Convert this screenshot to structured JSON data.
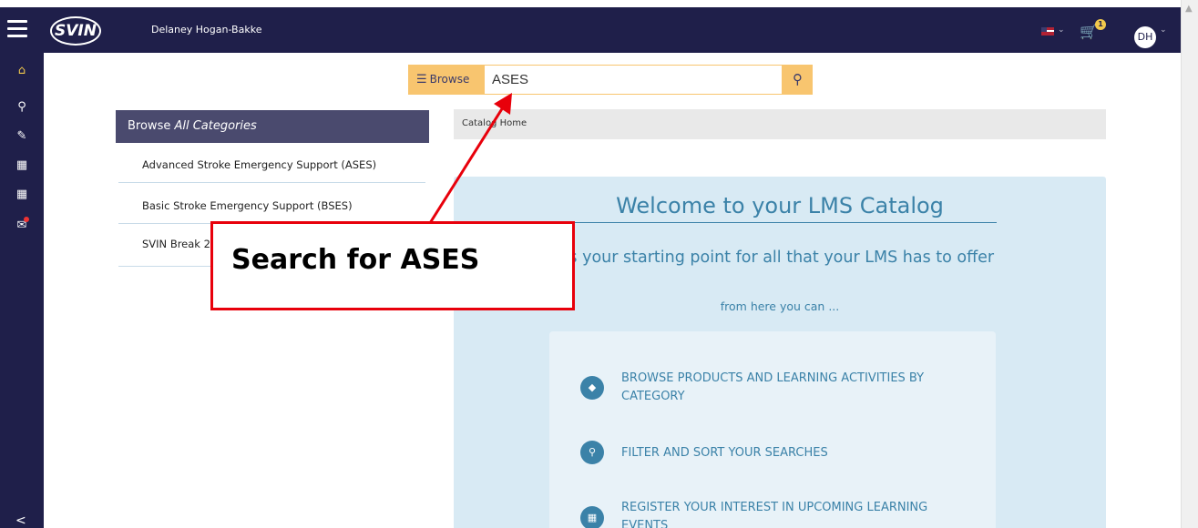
{
  "header": {
    "logo_text": "SVIN",
    "user_name": "Delaney Hogan-Bakke",
    "cart_count": "1",
    "avatar_initials": "DH"
  },
  "search": {
    "browse_label": "Browse",
    "value": "ASES"
  },
  "categories": {
    "header_prefix": "Browse ",
    "header_emphasis": "All Categories",
    "items": [
      "Advanced Stroke Emergency Support (ASES)",
      "Basic Stroke Emergency Support (BSES)",
      "SVIN Break 2"
    ]
  },
  "breadcrumb": {
    "label": "Catalog Home"
  },
  "welcome": {
    "title": "Welcome to your LMS Catalog",
    "intro": "s is your starting point for all that your LMS has to offer",
    "sub": "from here you can ...",
    "options": [
      {
        "icon": "tag-icon",
        "text": "BROWSE PRODUCTS AND LEARNING ACTIVITIES BY CATEGORY"
      },
      {
        "icon": "search-icon",
        "text": "FILTER AND SORT YOUR SEARCHES"
      },
      {
        "icon": "calendar-icon",
        "text": "REGISTER YOUR INTEREST IN UPCOMING LEARNING EVENTS"
      }
    ]
  },
  "annotation": {
    "text": "Search for ASES"
  },
  "colors": {
    "navbar": "#1f1f4a",
    "accent": "#f8c56f",
    "welcome_bg": "#d8eaf4",
    "welcome_text": "#3b82a8",
    "callout_border": "#e8000b"
  }
}
